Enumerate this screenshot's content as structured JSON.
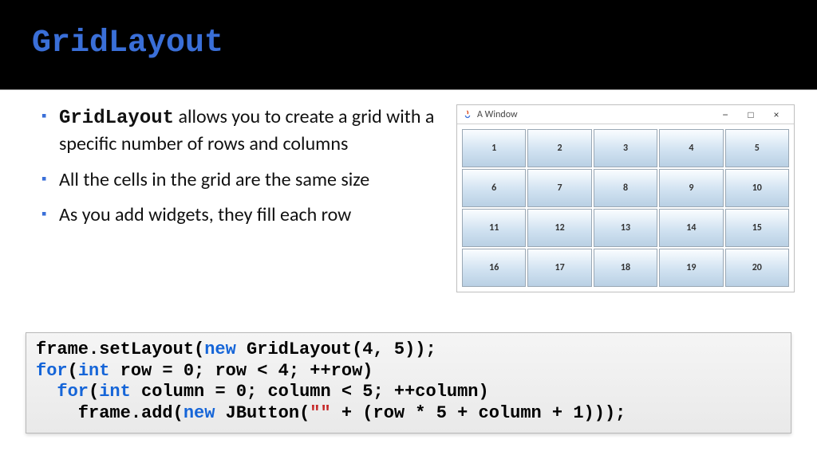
{
  "title": "GridLayout",
  "bullets": {
    "b1_strong": "GridLayout",
    "b1_rest": " allows you to create a grid with a specific number of rows and columns",
    "b2": "All the cells in the grid are the same size",
    "b3": "As you add widgets, they fill each row"
  },
  "window": {
    "title": "A Window",
    "minimize": "−",
    "maximize": "□",
    "close": "×",
    "cells": [
      "1",
      "2",
      "3",
      "4",
      "5",
      "6",
      "7",
      "8",
      "9",
      "10",
      "11",
      "12",
      "13",
      "14",
      "15",
      "16",
      "17",
      "18",
      "19",
      "20"
    ]
  },
  "code": {
    "t01": "frame.setLayout(",
    "kw_new1": "new",
    "t02": " GridLayout(4, 5));",
    "kw_for1": "for",
    "t03": "(",
    "kw_int1": "int",
    "t04": " row = 0; row < 4; ++row)",
    "kw_for2": "for",
    "t05": "(",
    "kw_int2": "int",
    "t06": " column = 0; column < 5; ++column)",
    "t07": "    frame.add(",
    "kw_new2": "new",
    "t08": " JButton(",
    "str_empty": "\"\"",
    "t09": " + (row * 5 + column + 1)));"
  }
}
